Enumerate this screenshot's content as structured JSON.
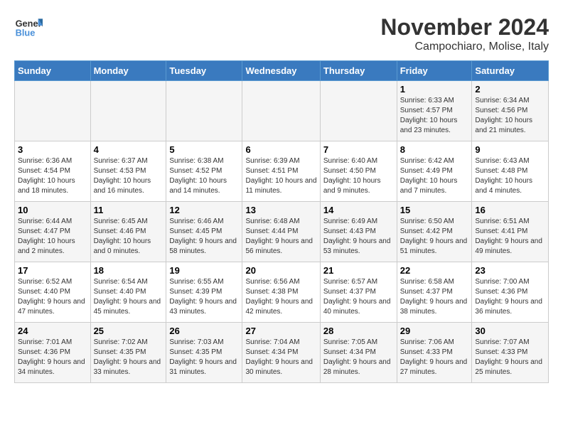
{
  "logo": {
    "line1": "General",
    "line2": "Blue"
  },
  "title": "November 2024",
  "location": "Campochiaro, Molise, Italy",
  "weekdays": [
    "Sunday",
    "Monday",
    "Tuesday",
    "Wednesday",
    "Thursday",
    "Friday",
    "Saturday"
  ],
  "weeks": [
    [
      {
        "day": "",
        "info": ""
      },
      {
        "day": "",
        "info": ""
      },
      {
        "day": "",
        "info": ""
      },
      {
        "day": "",
        "info": ""
      },
      {
        "day": "",
        "info": ""
      },
      {
        "day": "1",
        "info": "Sunrise: 6:33 AM\nSunset: 4:57 PM\nDaylight: 10 hours and 23 minutes."
      },
      {
        "day": "2",
        "info": "Sunrise: 6:34 AM\nSunset: 4:56 PM\nDaylight: 10 hours and 21 minutes."
      }
    ],
    [
      {
        "day": "3",
        "info": "Sunrise: 6:36 AM\nSunset: 4:54 PM\nDaylight: 10 hours and 18 minutes."
      },
      {
        "day": "4",
        "info": "Sunrise: 6:37 AM\nSunset: 4:53 PM\nDaylight: 10 hours and 16 minutes."
      },
      {
        "day": "5",
        "info": "Sunrise: 6:38 AM\nSunset: 4:52 PM\nDaylight: 10 hours and 14 minutes."
      },
      {
        "day": "6",
        "info": "Sunrise: 6:39 AM\nSunset: 4:51 PM\nDaylight: 10 hours and 11 minutes."
      },
      {
        "day": "7",
        "info": "Sunrise: 6:40 AM\nSunset: 4:50 PM\nDaylight: 10 hours and 9 minutes."
      },
      {
        "day": "8",
        "info": "Sunrise: 6:42 AM\nSunset: 4:49 PM\nDaylight: 10 hours and 7 minutes."
      },
      {
        "day": "9",
        "info": "Sunrise: 6:43 AM\nSunset: 4:48 PM\nDaylight: 10 hours and 4 minutes."
      }
    ],
    [
      {
        "day": "10",
        "info": "Sunrise: 6:44 AM\nSunset: 4:47 PM\nDaylight: 10 hours and 2 minutes."
      },
      {
        "day": "11",
        "info": "Sunrise: 6:45 AM\nSunset: 4:46 PM\nDaylight: 10 hours and 0 minutes."
      },
      {
        "day": "12",
        "info": "Sunrise: 6:46 AM\nSunset: 4:45 PM\nDaylight: 9 hours and 58 minutes."
      },
      {
        "day": "13",
        "info": "Sunrise: 6:48 AM\nSunset: 4:44 PM\nDaylight: 9 hours and 56 minutes."
      },
      {
        "day": "14",
        "info": "Sunrise: 6:49 AM\nSunset: 4:43 PM\nDaylight: 9 hours and 53 minutes."
      },
      {
        "day": "15",
        "info": "Sunrise: 6:50 AM\nSunset: 4:42 PM\nDaylight: 9 hours and 51 minutes."
      },
      {
        "day": "16",
        "info": "Sunrise: 6:51 AM\nSunset: 4:41 PM\nDaylight: 9 hours and 49 minutes."
      }
    ],
    [
      {
        "day": "17",
        "info": "Sunrise: 6:52 AM\nSunset: 4:40 PM\nDaylight: 9 hours and 47 minutes."
      },
      {
        "day": "18",
        "info": "Sunrise: 6:54 AM\nSunset: 4:40 PM\nDaylight: 9 hours and 45 minutes."
      },
      {
        "day": "19",
        "info": "Sunrise: 6:55 AM\nSunset: 4:39 PM\nDaylight: 9 hours and 43 minutes."
      },
      {
        "day": "20",
        "info": "Sunrise: 6:56 AM\nSunset: 4:38 PM\nDaylight: 9 hours and 42 minutes."
      },
      {
        "day": "21",
        "info": "Sunrise: 6:57 AM\nSunset: 4:37 PM\nDaylight: 9 hours and 40 minutes."
      },
      {
        "day": "22",
        "info": "Sunrise: 6:58 AM\nSunset: 4:37 PM\nDaylight: 9 hours and 38 minutes."
      },
      {
        "day": "23",
        "info": "Sunrise: 7:00 AM\nSunset: 4:36 PM\nDaylight: 9 hours and 36 minutes."
      }
    ],
    [
      {
        "day": "24",
        "info": "Sunrise: 7:01 AM\nSunset: 4:36 PM\nDaylight: 9 hours and 34 minutes."
      },
      {
        "day": "25",
        "info": "Sunrise: 7:02 AM\nSunset: 4:35 PM\nDaylight: 9 hours and 33 minutes."
      },
      {
        "day": "26",
        "info": "Sunrise: 7:03 AM\nSunset: 4:35 PM\nDaylight: 9 hours and 31 minutes."
      },
      {
        "day": "27",
        "info": "Sunrise: 7:04 AM\nSunset: 4:34 PM\nDaylight: 9 hours and 30 minutes."
      },
      {
        "day": "28",
        "info": "Sunrise: 7:05 AM\nSunset: 4:34 PM\nDaylight: 9 hours and 28 minutes."
      },
      {
        "day": "29",
        "info": "Sunrise: 7:06 AM\nSunset: 4:33 PM\nDaylight: 9 hours and 27 minutes."
      },
      {
        "day": "30",
        "info": "Sunrise: 7:07 AM\nSunset: 4:33 PM\nDaylight: 9 hours and 25 minutes."
      }
    ]
  ]
}
